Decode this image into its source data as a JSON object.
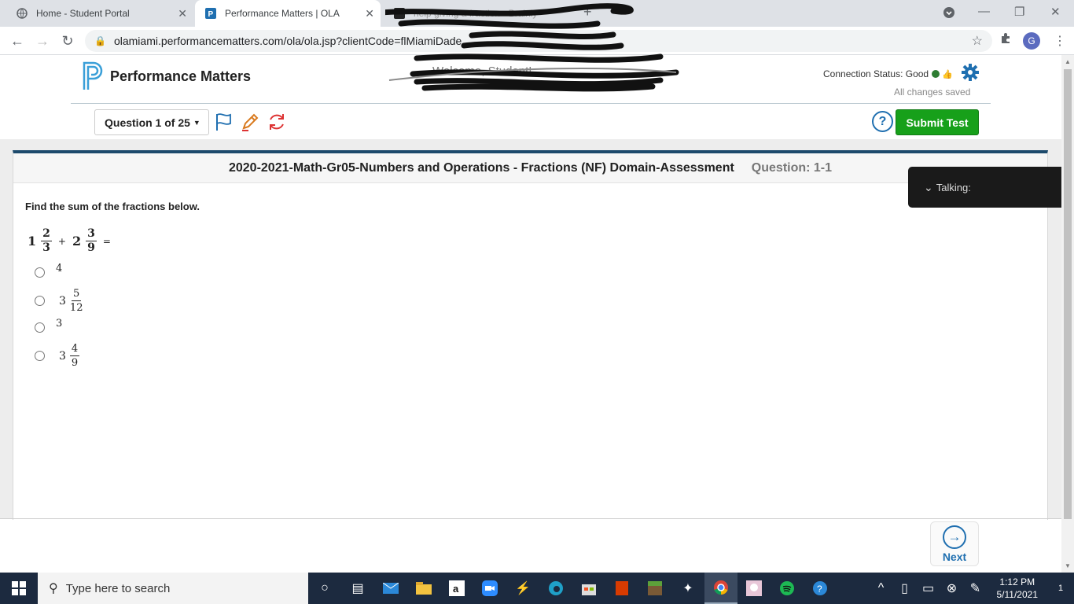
{
  "browser": {
    "tabs": [
      {
        "title": "Home - Student Portal"
      },
      {
        "title": "Performance Matters | OLA"
      },
      {
        "title": "help giving a fraction - Brainly"
      }
    ],
    "url": "olamiami.performancematters.com/ola/ola.jsp?clientCode=flMiamiDade",
    "profile_initial": "G"
  },
  "header": {
    "logo_text": "Performance Matters",
    "welcome_text": "Welcome, Student!",
    "connection_status": "Connection Status: Good",
    "saved_status": "All changes saved",
    "question_selector": "Question 1 of 25",
    "help_label": "?",
    "submit_label": "Submit Test"
  },
  "assessment": {
    "title": "2020-2021-Math-Gr05-Numbers and Operations - Fractions (NF) Domain-Assessment",
    "question_label": "Question: 1-1",
    "prompt": "Find the sum of the fractions below.",
    "expression": {
      "a_whole": "1",
      "a_num": "2",
      "a_den": "3",
      "operator": "+",
      "b_whole": "2",
      "b_num": "3",
      "b_den": "9",
      "equals": "="
    },
    "choices": [
      {
        "whole": "4"
      },
      {
        "whole": "3",
        "num": "5",
        "den": "12"
      },
      {
        "whole": "3"
      },
      {
        "whole": "3",
        "num": "4",
        "den": "9"
      }
    ]
  },
  "talking_panel": {
    "label": "Talking:"
  },
  "footer": {
    "next_label": "Next"
  },
  "taskbar": {
    "search_placeholder": "Type here to search",
    "time": "1:12 PM",
    "date": "5/11/2021",
    "notifications": "1"
  },
  "colors": {
    "submit": "#17a01a",
    "brand_blue": "#1f6fb0",
    "card_border": "#1d4a6c"
  }
}
